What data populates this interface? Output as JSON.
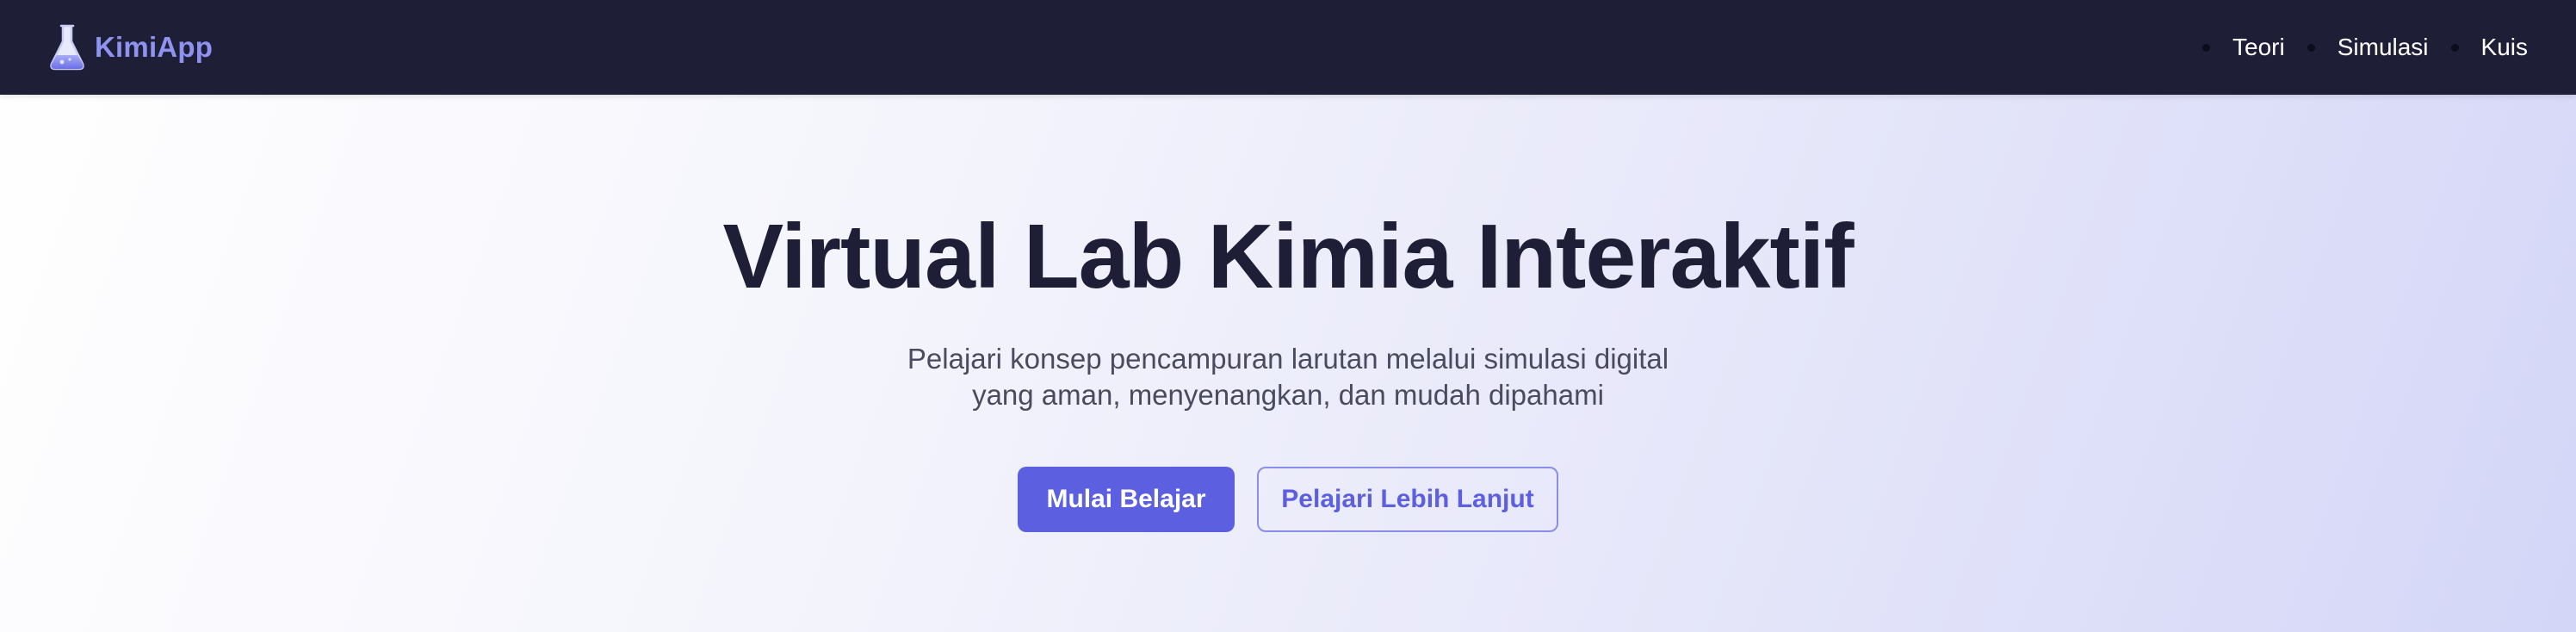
{
  "navbar": {
    "brand": {
      "icon": "flask-icon",
      "name": "KimiApp",
      "color": "#8e92f0"
    },
    "links": [
      {
        "label": "Teori"
      },
      {
        "label": "Simulasi"
      },
      {
        "label": "Kuis"
      }
    ],
    "background": "#1e1f36"
  },
  "hero": {
    "title": "Virtual Lab Kimia Interaktif",
    "subtitle": "Pelajari konsep pencampuran larutan melalui simulasi digital yang aman, menyenangkan, dan mudah dipahami",
    "primary_button": "Mulai Belajar",
    "secondary_button": "Pelajari Lebih Lanjut",
    "accent_color": "#5b5fe0"
  }
}
